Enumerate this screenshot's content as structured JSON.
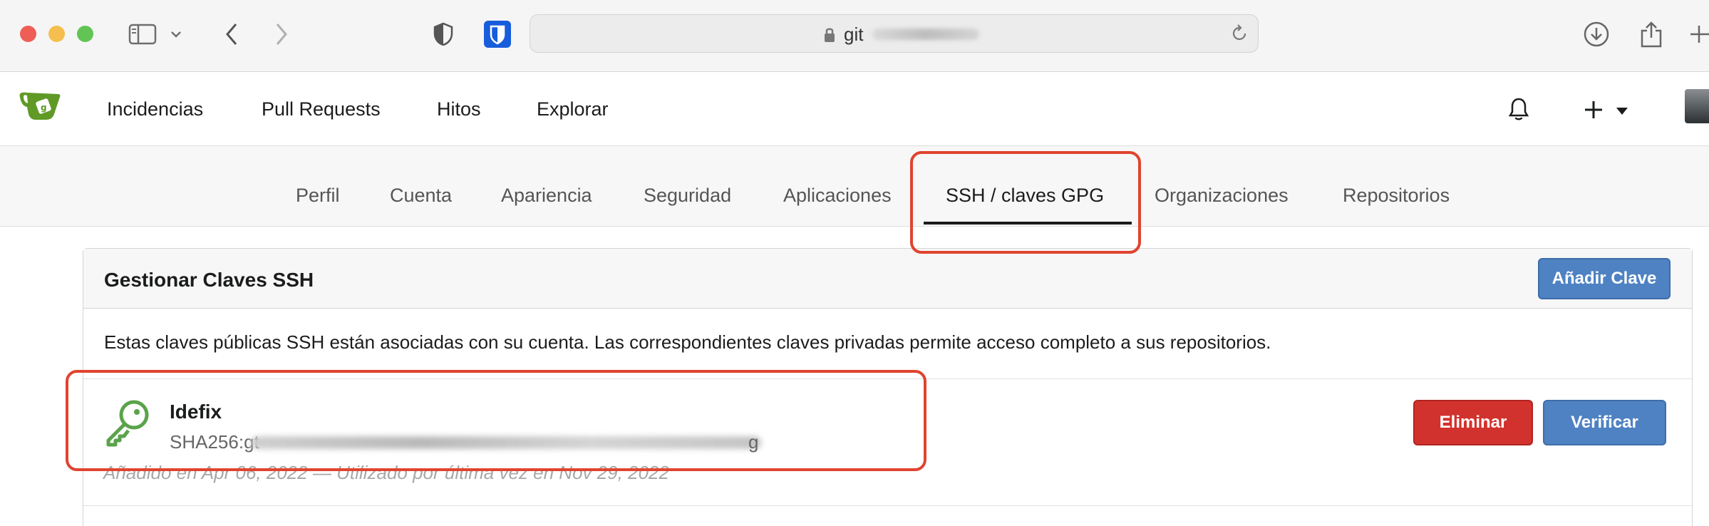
{
  "browser": {
    "url_prefix": "git",
    "icons": [
      "sidebar-icon",
      "chevron-down-icon",
      "back-icon",
      "forward-icon",
      "privacy-shield-icon",
      "bitwarden-icon",
      "lock-icon",
      "reload-icon",
      "download-icon",
      "share-icon",
      "new-tab-icon"
    ]
  },
  "nav": {
    "logo": "gitea-logo",
    "items": [
      "Incidencias",
      "Pull Requests",
      "Hitos",
      "Explorar"
    ],
    "icons": [
      "bell-icon",
      "plus-icon",
      "avatar"
    ]
  },
  "settings_tabs": {
    "items": [
      "Perfil",
      "Cuenta",
      "Apariencia",
      "Seguridad",
      "Aplicaciones",
      "SSH / claves GPG",
      "Organizaciones",
      "Repositorios"
    ],
    "active": "SSH / claves GPG"
  },
  "ssh_panel": {
    "title": "Gestionar Claves SSH",
    "add_button": "Añadir Clave",
    "description": "Estas claves públicas SSH están asociadas con su cuenta. Las correspondientes claves privadas permite acceso completo a sus repositorios.",
    "keys": [
      {
        "name": "Idefix",
        "fingerprint_prefix": "SHA256:gt",
        "fingerprint_suffix": "g",
        "meta": "Añadido en Apr 06, 2022 — Utilizado por última vez en Nov 29, 2022",
        "delete_label": "Eliminar",
        "verify_label": "Verificar"
      }
    ]
  },
  "colors": {
    "annotation": "#e0442f",
    "primary_button": "#4f82c2",
    "danger_button": "#d2322d",
    "key_icon": "#5aa34a",
    "logo_green": "#609926"
  }
}
